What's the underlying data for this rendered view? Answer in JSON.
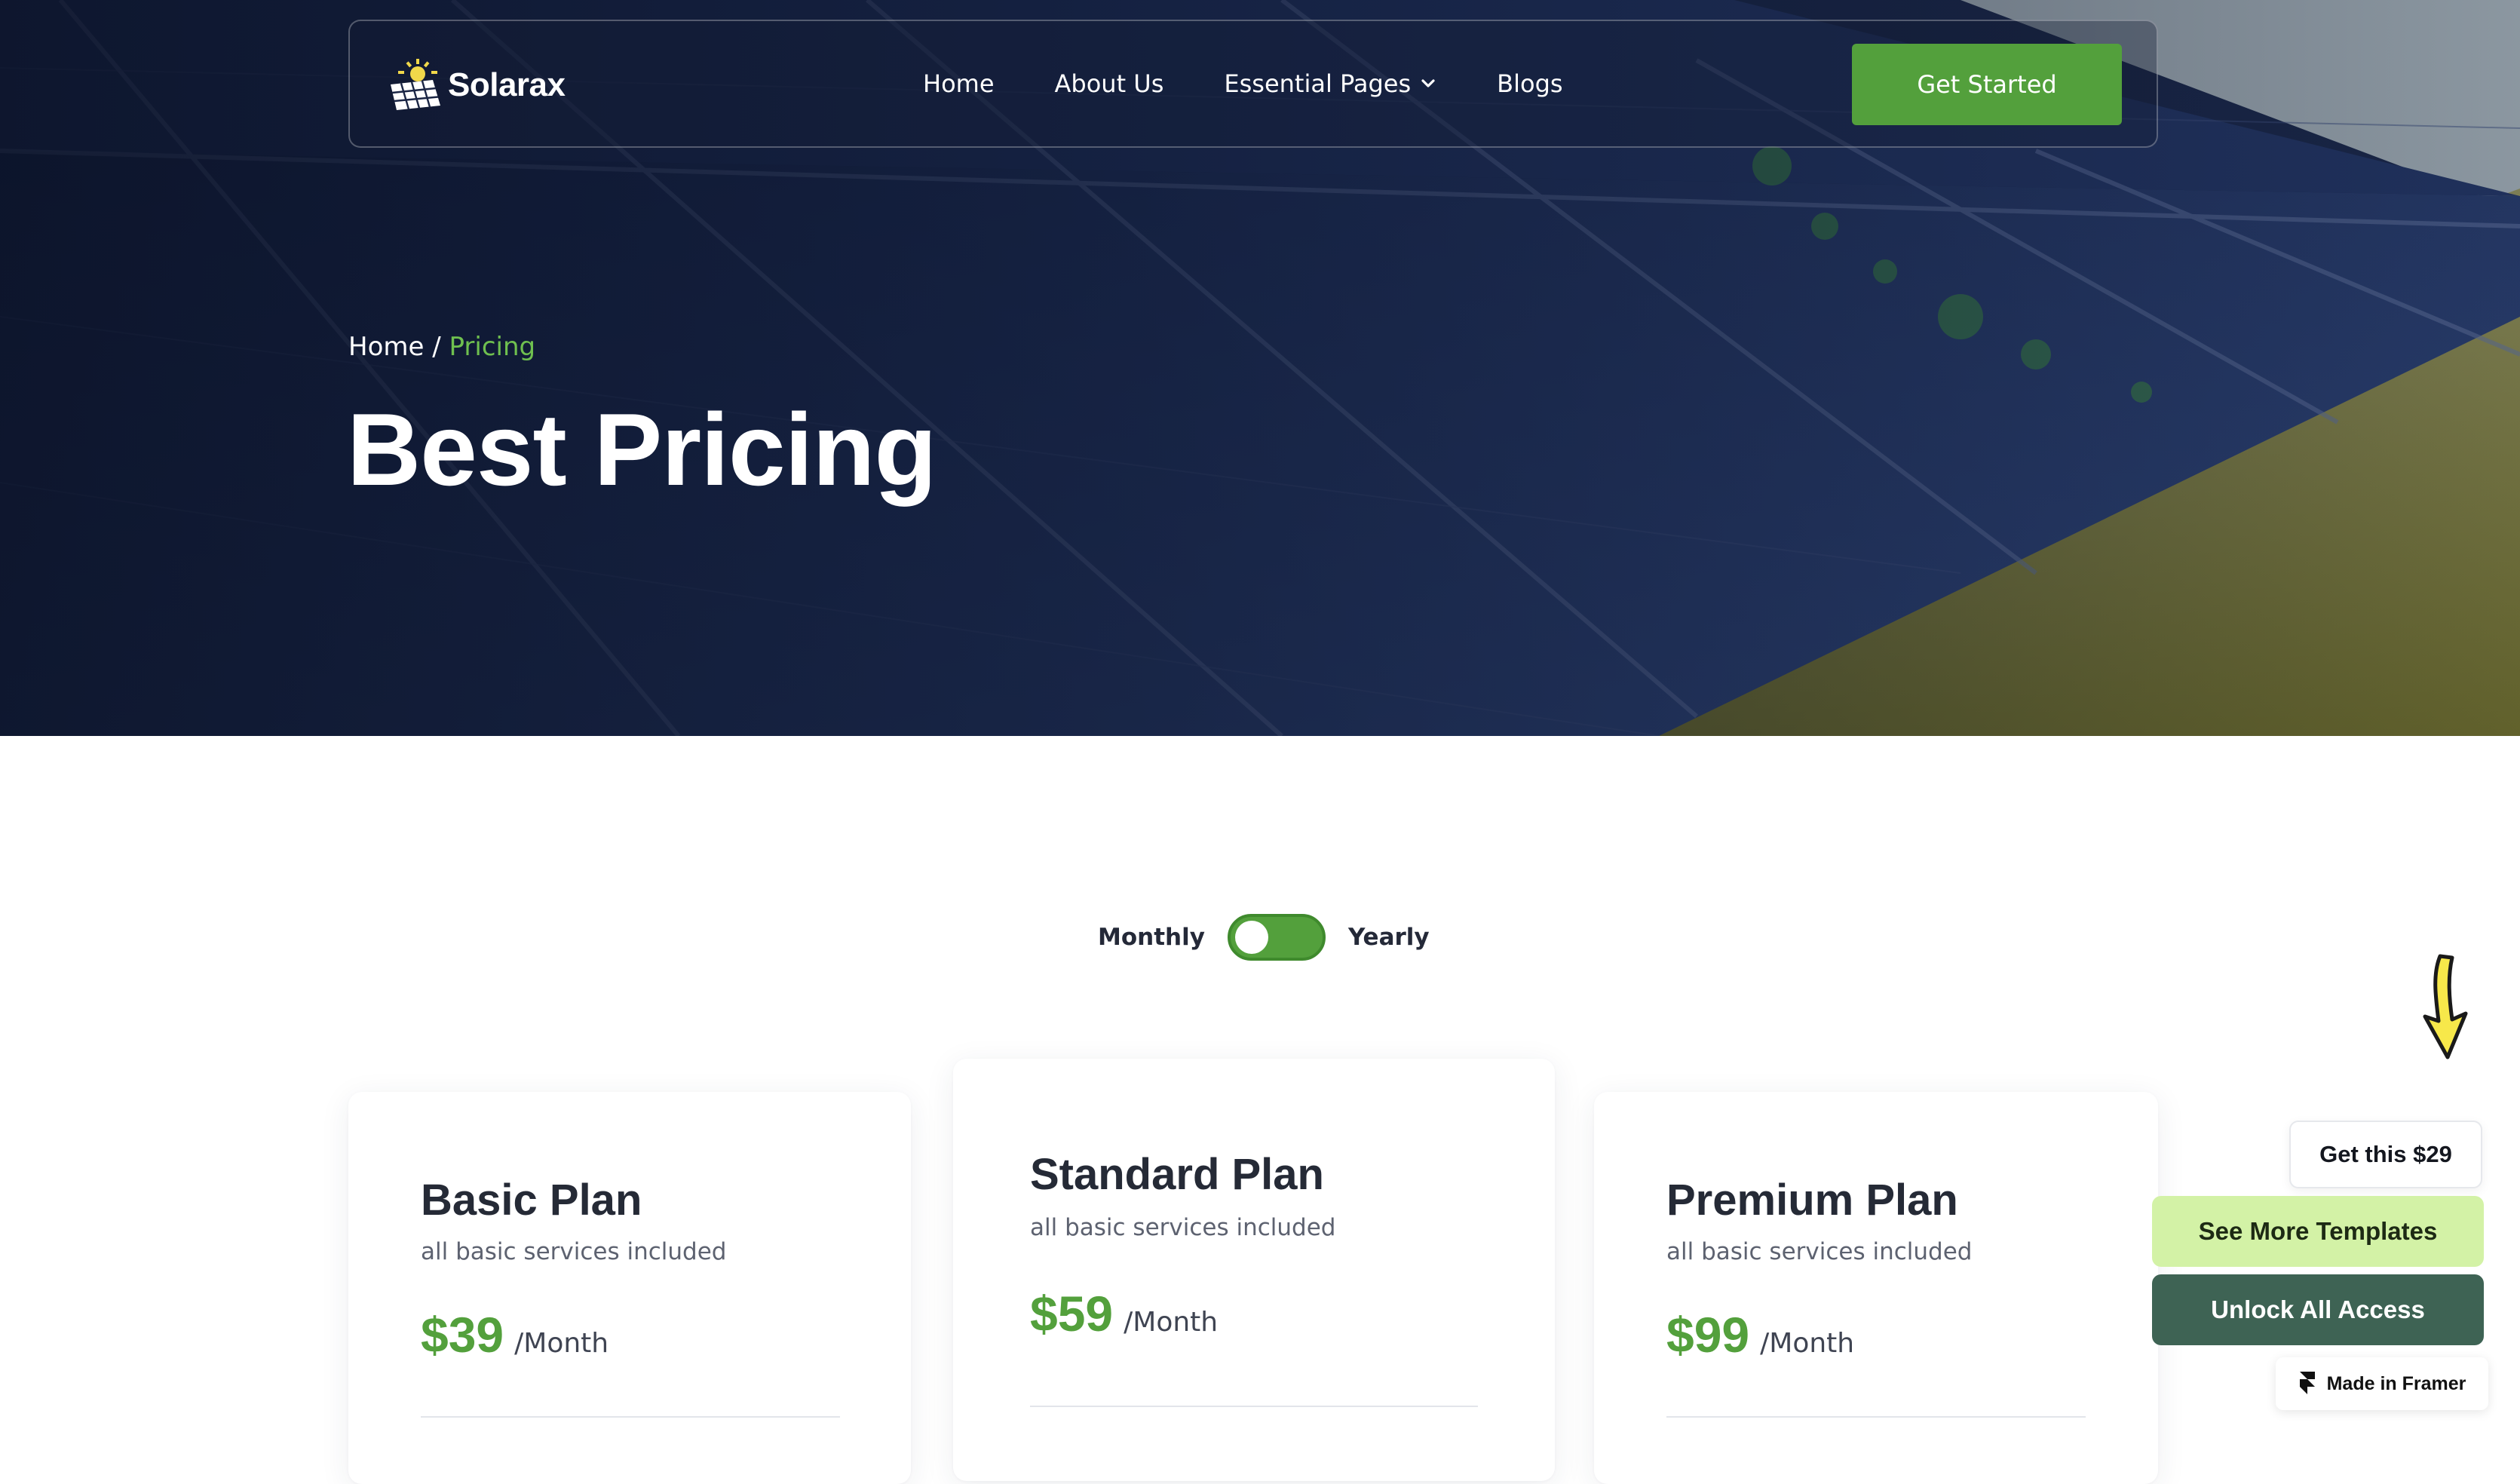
{
  "nav": {
    "brand": "Solarax",
    "links": [
      {
        "label": "Home"
      },
      {
        "label": "About Us"
      },
      {
        "label": "Essential Pages",
        "has_dropdown": true
      },
      {
        "label": "Blogs"
      }
    ],
    "cta_label": "Get Started"
  },
  "hero": {
    "breadcrumb_home": "Home",
    "breadcrumb_separator": "/",
    "breadcrumb_current": "Pricing",
    "title": "Best Pricing"
  },
  "billing_toggle": {
    "monthly_label": "Monthly",
    "yearly_label": "Yearly",
    "selected": "Monthly"
  },
  "plans": [
    {
      "name": "Basic Plan",
      "description": "all basic services included",
      "price": "$39",
      "period": "/Month"
    },
    {
      "name": "Standard Plan",
      "description": "all basic services included",
      "price": "$59",
      "period": "/Month"
    },
    {
      "name": "Premium Plan",
      "description": "all basic services included",
      "price": "$99",
      "period": "/Month"
    }
  ],
  "promo": {
    "get_this": "Get this $29",
    "see_more": "See More Templates",
    "unlock": "Unlock All Access",
    "made_in": "Made in Framer"
  },
  "icons": [
    "solar-panel-logo-icon",
    "chevron-down-icon",
    "arrow-down-icon",
    "framer-logo-icon"
  ],
  "colors": {
    "accent_green": "#53a03c",
    "breadcrumb_green": "#6fc04f",
    "promo_light_green": "#d3f2a6",
    "promo_dark_green": "#3e6354",
    "arrow_yellow": "#f7e84a"
  }
}
